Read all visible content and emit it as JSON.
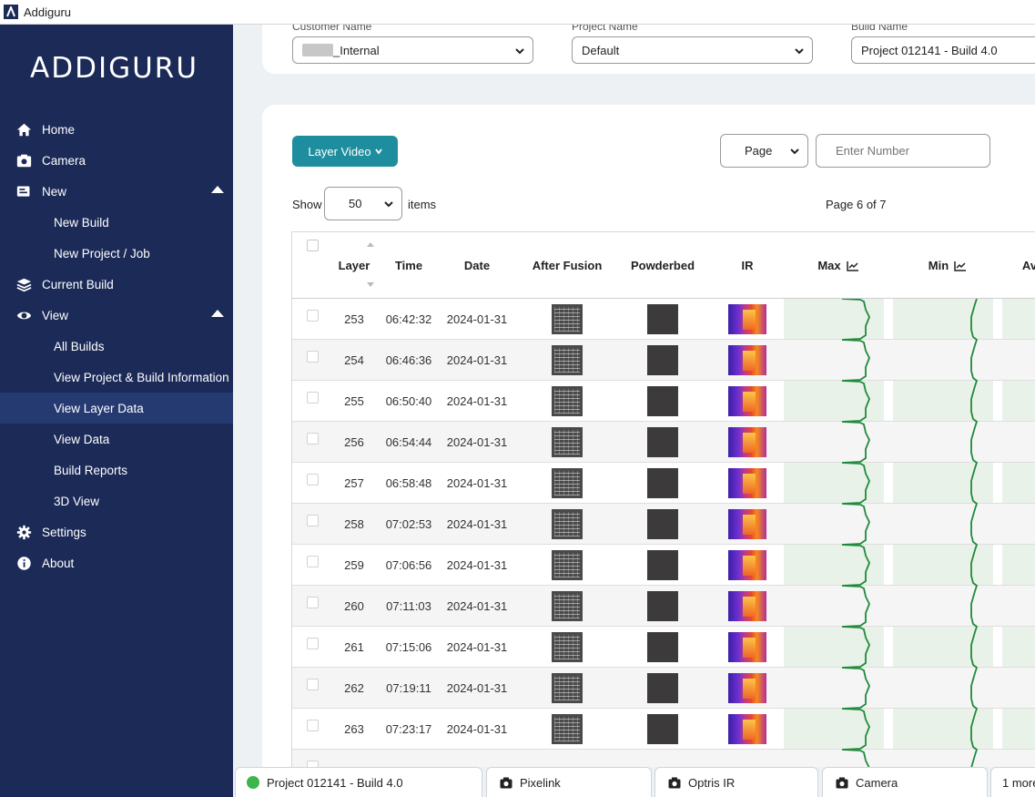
{
  "window": {
    "title": "Addiguru"
  },
  "sidebar": {
    "logo": "ADDIGURU",
    "items": [
      {
        "label": "Home",
        "icon": "home-icon"
      },
      {
        "label": "Camera",
        "icon": "camera-icon"
      },
      {
        "label": "New",
        "icon": "new-icon"
      },
      {
        "label": "New Build"
      },
      {
        "label": "New Project / Job"
      },
      {
        "label": "Current Build",
        "icon": "layers-icon"
      },
      {
        "label": "View",
        "icon": "eye-icon"
      },
      {
        "label": "All Builds"
      },
      {
        "label": "View Project & Build Information"
      },
      {
        "label": "View Layer Data"
      },
      {
        "label": "View Data"
      },
      {
        "label": "Build Reports"
      },
      {
        "label": "3D View"
      },
      {
        "label": "Settings",
        "icon": "gear-icon"
      },
      {
        "label": "About",
        "icon": "info-icon"
      }
    ],
    "active": "View Layer Data"
  },
  "filters": {
    "customer": {
      "label": "Customer Name",
      "value": "_Internal"
    },
    "project": {
      "label": "Project Name",
      "value": "Default"
    },
    "build": {
      "label": "Build Name",
      "value": "Project 012141 - Build 4.0"
    }
  },
  "toolbar": {
    "layer_video": "Layer Video",
    "page_select": "Page",
    "page_input_placeholder": "Enter Number",
    "show": "Show",
    "items_per_page": "50",
    "items": "items",
    "page_status": "Page 6 of 7"
  },
  "table": {
    "columns": [
      "Layer",
      "Time",
      "Date",
      "After Fusion",
      "Powderbed",
      "IR",
      "Max",
      "Min",
      "Av"
    ],
    "rows": [
      {
        "layer": "253",
        "time": "06:42:32",
        "date": "2024-01-31"
      },
      {
        "layer": "254",
        "time": "06:46:36",
        "date": "2024-01-31"
      },
      {
        "layer": "255",
        "time": "06:50:40",
        "date": "2024-01-31"
      },
      {
        "layer": "256",
        "time": "06:54:44",
        "date": "2024-01-31"
      },
      {
        "layer": "257",
        "time": "06:58:48",
        "date": "2024-01-31"
      },
      {
        "layer": "258",
        "time": "07:02:53",
        "date": "2024-01-31"
      },
      {
        "layer": "259",
        "time": "07:06:56",
        "date": "2024-01-31"
      },
      {
        "layer": "260",
        "time": "07:11:03",
        "date": "2024-01-31"
      },
      {
        "layer": "261",
        "time": "07:15:06",
        "date": "2024-01-31"
      },
      {
        "layer": "262",
        "time": "07:19:11",
        "date": "2024-01-31"
      },
      {
        "layer": "263",
        "time": "07:23:17",
        "date": "2024-01-31"
      }
    ]
  },
  "taskbar": {
    "tabs": [
      {
        "label": "Project 012141 - Build 4.0",
        "status_color": "#3cb54a"
      },
      {
        "label": "Pixelink",
        "icon": "camera-icon"
      },
      {
        "label": "Optris IR",
        "icon": "camera-icon"
      },
      {
        "label": "Camera",
        "icon": "camera-icon"
      },
      {
        "label": "1 more"
      }
    ]
  },
  "colors": {
    "sidebar_bg": "#1b2a57",
    "sidebar_active": "#263a72",
    "accent_button": "#1e8e9e",
    "chart_line": "#1f8a3a",
    "chart_bg": "#e9f2e9"
  }
}
